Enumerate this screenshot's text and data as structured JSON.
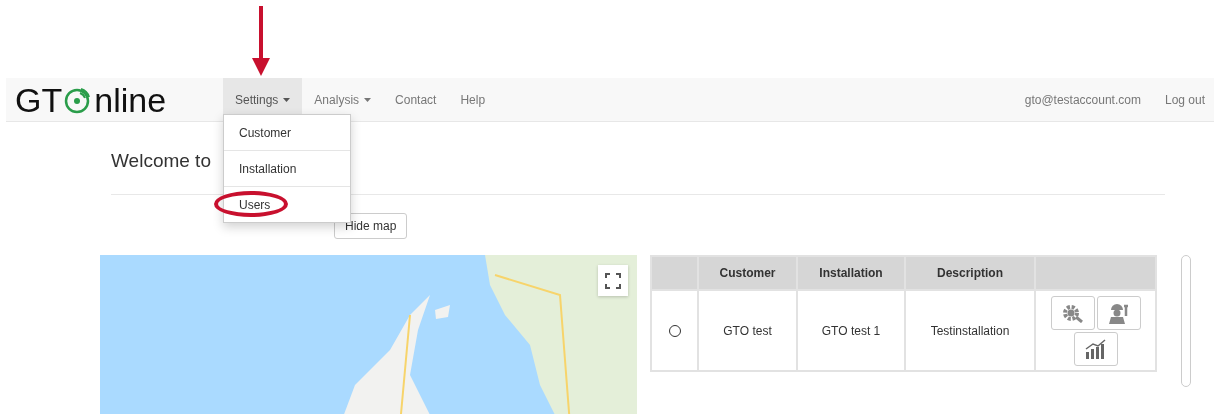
{
  "navbar": {
    "logo": {
      "before": "GT",
      "after": "nline"
    },
    "menu": [
      {
        "label": "Settings",
        "dropdown": true,
        "selected": true
      },
      {
        "label": "Analysis",
        "dropdown": true,
        "selected": false
      },
      {
        "label": "Contact",
        "dropdown": false,
        "selected": false
      },
      {
        "label": "Help",
        "dropdown": false,
        "selected": false
      }
    ],
    "account": "gto@testaccount.com",
    "logout": "Log out"
  },
  "dropdown": [
    {
      "label": "Customer",
      "circled": false
    },
    {
      "label": "Installation",
      "circled": false
    },
    {
      "label": "Users",
      "circled": true
    }
  ],
  "heading": "Welcome to",
  "hide_map_button": "Hide map",
  "table": {
    "columns": [
      "Customer",
      "Installation",
      "Description"
    ],
    "rows": [
      {
        "selected": false,
        "cells": [
          "GTO test",
          "GTO test 1",
          "Testinstallation"
        ]
      }
    ]
  }
}
